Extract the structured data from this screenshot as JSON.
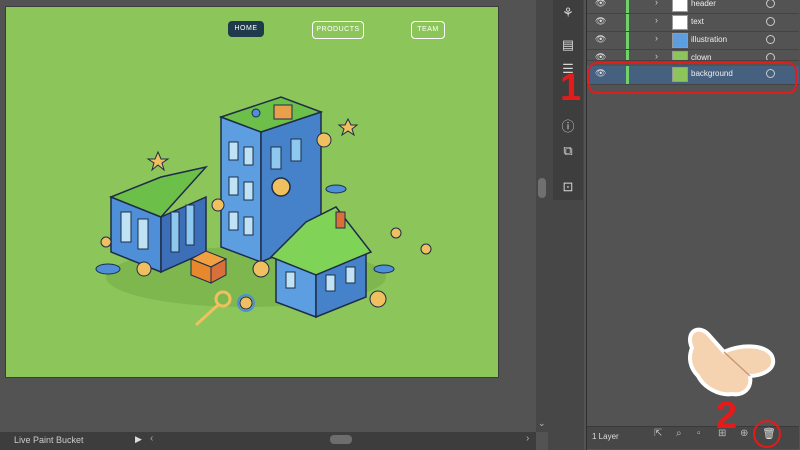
{
  "artboard": {
    "nav": [
      "HOME",
      "PRODUCTS",
      "TEAM"
    ]
  },
  "status_bar": {
    "tool_name": "Live Paint Bucket"
  },
  "layers": [
    {
      "name": "header",
      "visible": true,
      "selected": false
    },
    {
      "name": "text",
      "visible": true,
      "selected": false
    },
    {
      "name": "illustration",
      "visible": true,
      "selected": false
    },
    {
      "name": "clown",
      "visible": true,
      "selected": false
    },
    {
      "name": "background",
      "visible": true,
      "selected": true
    }
  ],
  "panel_footer": {
    "layer_count": "1 Layer"
  },
  "annotations": {
    "step1": "1",
    "step2": "2"
  },
  "icons": {
    "eye": "eye-icon",
    "chevron": "chevron-right-icon",
    "trash": "trash-icon",
    "hand": "pointing-hand-icon"
  },
  "colors": {
    "accent": "#e31b1b",
    "background_layer": "#8cc65a",
    "layer_color_bar": "#6fd36a",
    "selected_row": "#46607f"
  }
}
